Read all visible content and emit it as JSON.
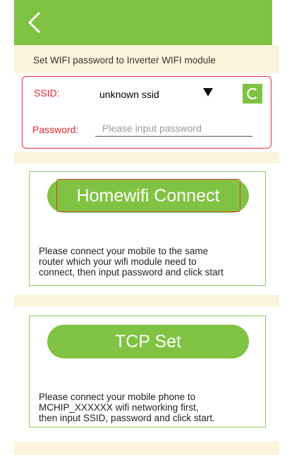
{
  "header": {
    "back_icon": "back-chevron-icon"
  },
  "subtitle": "Set WIFI password to Inverter WIFI module",
  "wifi": {
    "ssid_label": "SSID:",
    "ssid_value": "unknown ssid",
    "dropdown_icon": "dropdown-triangle-icon",
    "refresh_icon": "refresh-icon",
    "password_label": "Password:",
    "password_placeholder": "Please input password",
    "password_value": ""
  },
  "homewifi": {
    "button_label": "Homewifi Connect",
    "description": [
      "Please connect your mobile to the same",
      "router which your wifi module need to",
      "connect, then input password and click start"
    ]
  },
  "tcp": {
    "button_label": "TCP Set",
    "description": [
      "Please connect your mobile phone to",
      "MCHIP_XXXXXX wifi networking first,",
      "then input SSID, password and click start."
    ]
  },
  "colors": {
    "accent_green": "#80c342",
    "alert_red": "#e3262e",
    "band_cream": "#fdf4dc",
    "panel_border": "#8fcb62"
  }
}
